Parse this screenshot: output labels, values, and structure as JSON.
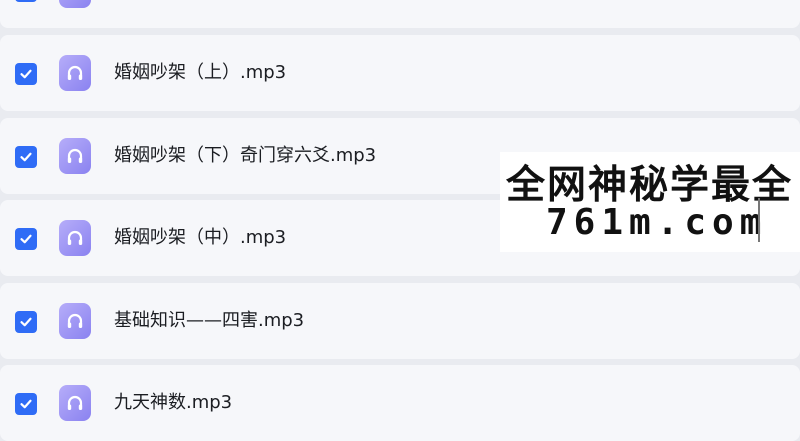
{
  "file_list": {
    "items": [
      {
        "name": "",
        "checked": true,
        "icon": "headphones-icon"
      },
      {
        "name": "婚姻吵架（上）.mp3",
        "checked": true,
        "icon": "headphones-icon"
      },
      {
        "name": "婚姻吵架（下）奇门穿六爻.mp3",
        "checked": true,
        "icon": "headphones-icon"
      },
      {
        "name": "婚姻吵架（中）.mp3",
        "checked": true,
        "icon": "headphones-icon"
      },
      {
        "name": "基础知识——四害.mp3",
        "checked": true,
        "icon": "headphones-icon"
      },
      {
        "name": "九天神数.mp3",
        "checked": true,
        "icon": "headphones-icon"
      }
    ]
  },
  "watermark": {
    "line1": "全网神秘学最全",
    "line2": "761m.com"
  },
  "colors": {
    "checkbox": "#2f6cf6",
    "audio_icon": "#9b93f4",
    "row_bg": "#f6f7fa",
    "page_bg": "#e9ebf0"
  }
}
